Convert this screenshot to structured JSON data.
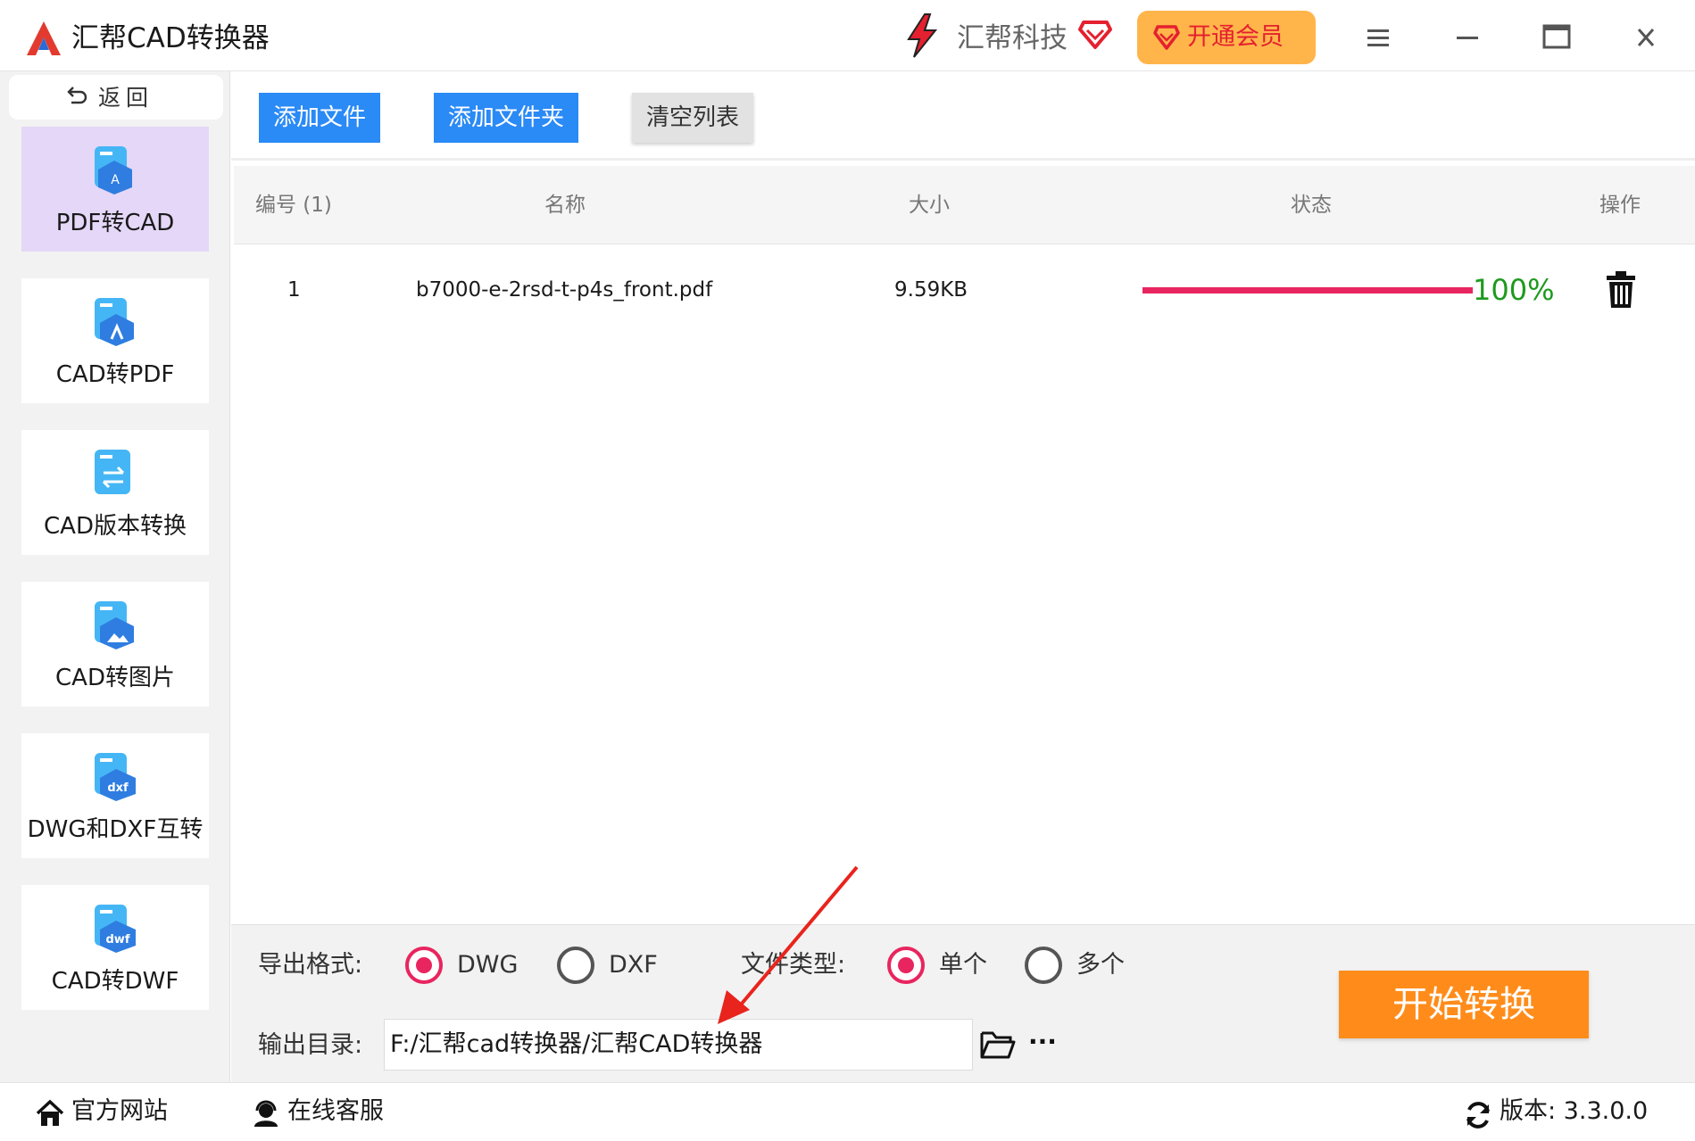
{
  "app": {
    "title": "汇帮CAD转换器"
  },
  "brand": {
    "name": "汇帮科技",
    "vip_label": "开通会员"
  },
  "colors": {
    "accent_blue": "#2a8af6",
    "accent_orange": "#ff8c1a",
    "progress": "#e8255f",
    "success": "#1d9a1d",
    "sidebar_active": "#e4d7f7"
  },
  "sidebar": {
    "back_label": "返回",
    "items": [
      {
        "label": "PDF转CAD",
        "icon": "pdf-to-cad-icon",
        "active": true
      },
      {
        "label": "CAD转PDF",
        "icon": "cad-to-pdf-icon",
        "active": false
      },
      {
        "label": "CAD版本转换",
        "icon": "cad-version-convert-icon",
        "active": false
      },
      {
        "label": "CAD转图片",
        "icon": "cad-to-image-icon",
        "active": false
      },
      {
        "label": "DWG和DXF互转",
        "icon": "dwg-dxf-convert-icon",
        "active": false
      },
      {
        "label": "CAD转DWF",
        "icon": "cad-to-dwf-icon",
        "active": false
      }
    ]
  },
  "toolbar": {
    "add_file": "添加文件",
    "add_folder": "添加文件夹",
    "clear_list": "清空列表"
  },
  "table": {
    "headers": {
      "no": "编号 (1)",
      "name": "名称",
      "size": "大小",
      "status": "状态",
      "action": "操作"
    },
    "rows": [
      {
        "no": "1",
        "name": "b7000-e-2rsd-t-p4s_front.pdf",
        "size": "9.59KB",
        "progress_text": "100%",
        "progress": 1.0
      }
    ]
  },
  "settings": {
    "format_label": "导出格式:",
    "format_options": [
      {
        "label": "DWG",
        "checked": true
      },
      {
        "label": "DXF",
        "checked": false
      }
    ],
    "file_type_label": "文件类型:",
    "file_type_options": [
      {
        "label": "单个",
        "checked": true
      },
      {
        "label": "多个",
        "checked": false
      }
    ],
    "output_label": "输出目录:",
    "output_path": "F:/汇帮cad转换器/汇帮CAD转换器",
    "more_label": "···",
    "start_button": "开始转换"
  },
  "footer": {
    "site": "官方网站",
    "service": "在线客服",
    "version": "版本: 3.3.0.0"
  }
}
